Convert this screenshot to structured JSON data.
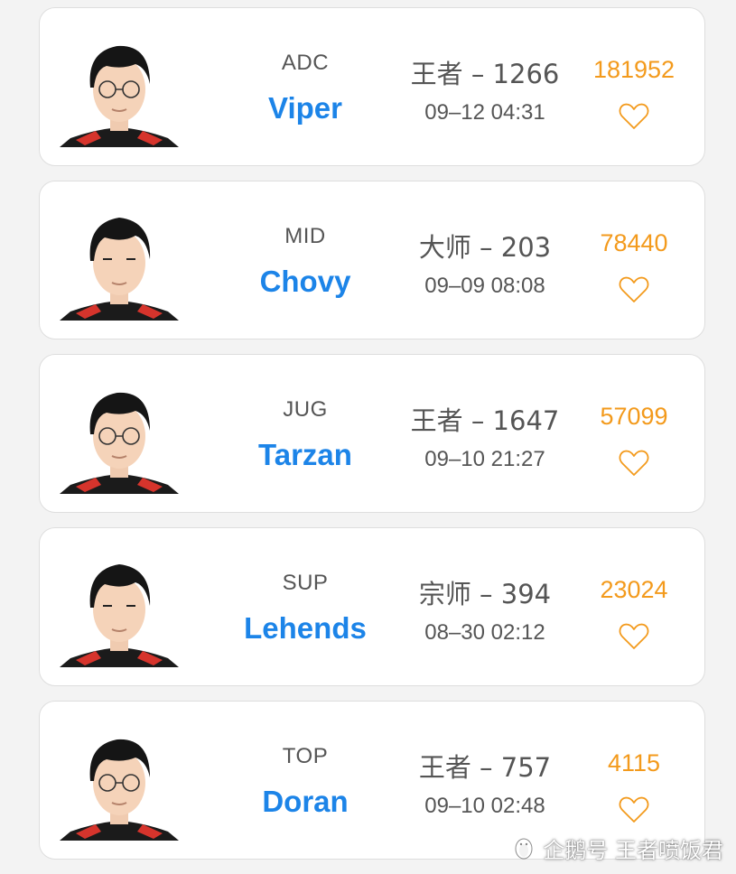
{
  "colors": {
    "role": "#555555",
    "name": "#1c84e8",
    "likes": "#f39a1c",
    "card_bg": "#ffffff",
    "page_bg": "#f3f3f3"
  },
  "players": [
    {
      "role": "ADC",
      "name": "Viper",
      "rank": "王者 – 1266",
      "time": "09–12 04:31",
      "likes": "181952",
      "like_icon": "heart-outline-icon"
    },
    {
      "role": "MID",
      "name": "Chovy",
      "rank": "大师 – 203",
      "time": "09–09 08:08",
      "likes": "78440",
      "like_icon": "heart-outline-icon"
    },
    {
      "role": "JUG",
      "name": "Tarzan",
      "rank": "王者 – 1647",
      "time": "09–10 21:27",
      "likes": "57099",
      "like_icon": "heart-outline-icon"
    },
    {
      "role": "SUP",
      "name": "Lehends",
      "rank": "宗师 – 394",
      "time": "08–30 02:12",
      "likes": "23024",
      "like_icon": "heart-outline-icon"
    },
    {
      "role": "TOP",
      "name": "Doran",
      "rank": "王者 – 757",
      "time": "09–10 02:48",
      "likes": "4115",
      "like_icon": "heart-outline-icon"
    }
  ],
  "watermark": {
    "text": "企鹅号 王者喷饭君",
    "icon": "penguin-logo-icon"
  }
}
